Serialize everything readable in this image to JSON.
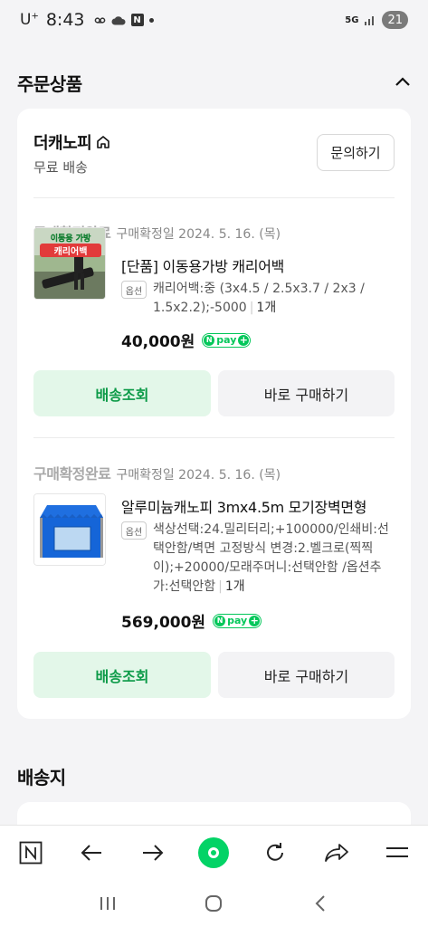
{
  "status_bar": {
    "carrier": "U",
    "carrier_sup": "+",
    "time": "8:43",
    "network": "5G",
    "battery": "21"
  },
  "order_section": {
    "title": "주문상품",
    "store": {
      "name": "더캐노피",
      "shipping": "무료 배송",
      "inquiry_label": "문의하기"
    },
    "items": [
      {
        "status": "구매확정완료",
        "date": "구매확정일 2024. 5. 16. (목)",
        "name": "[단품] 이동용가방 캐리어백",
        "option_badge": "옵션",
        "option_text": "캐리어백:중 (3x4.5 / 2.5x3.7 / 2x3 / 1.5x2.2);-5000",
        "qty": "1개",
        "price": "40,000원",
        "thumb_line1": "이동용 가방",
        "thumb_line2": "캐리어백",
        "track_label": "배송조회",
        "buy_label": "바로 구매하기"
      },
      {
        "status": "구매확정완료",
        "date": "구매확정일 2024. 5. 16. (목)",
        "name": "알루미늄캐노피 3mx4.5m 모기장벽면형",
        "option_badge": "옵션",
        "option_text": "색상선택:24.밀리터리;+100000/인쇄비:선택안함/벽면 고정방식 변경:2.벨크로(찍찍이);+20000/모래주머니:선택안함 /옵션추가:선택안함",
        "qty": "1개",
        "price": "569,000원",
        "track_label": "배송조회",
        "buy_label": "바로 구매하기"
      }
    ],
    "npay_label": "pay"
  },
  "address_section": {
    "title": "배송지"
  },
  "icons": {
    "home": "home-icon",
    "collapse": "chevron-up-icon",
    "naver": "naver-icon",
    "back": "arrow-left-icon",
    "forward": "arrow-right-icon",
    "reload": "reload-icon",
    "share": "share-icon",
    "menu": "menu-icon"
  },
  "colors": {
    "accent": "#03c75a",
    "track_bg": "#e3f7e9",
    "track_text": "#0b9a47",
    "status_gray": "#a9a9a9"
  }
}
